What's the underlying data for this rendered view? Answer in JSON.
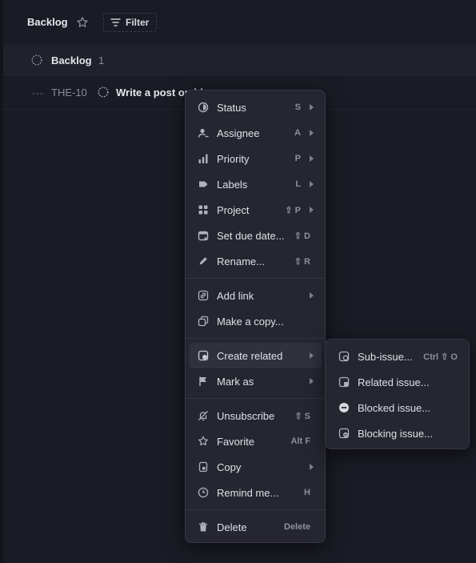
{
  "header": {
    "title": "Backlog",
    "filter_label": "Filter"
  },
  "group": {
    "name": "Backlog",
    "count": "1"
  },
  "issue": {
    "priority": "---",
    "id": "THE-10",
    "title": "Write a post on blo"
  },
  "context_menu": {
    "items": [
      {
        "label": "Status",
        "shortcut": "S",
        "icon": "status-icon",
        "submenu": true
      },
      {
        "label": "Assignee",
        "shortcut": "A",
        "icon": "assignee-icon",
        "submenu": true
      },
      {
        "label": "Priority",
        "shortcut": "P",
        "icon": "priority-icon",
        "submenu": true
      },
      {
        "label": "Labels",
        "shortcut": "L",
        "icon": "label-icon",
        "submenu": true
      },
      {
        "label": "Project",
        "shortcut": "⇧ P",
        "icon": "project-icon",
        "submenu": true
      },
      {
        "label": "Set due date...",
        "shortcut": "⇧ D",
        "icon": "calendar-icon",
        "submenu": false
      },
      {
        "label": "Rename...",
        "shortcut": "⇧ R",
        "icon": "pencil-icon",
        "submenu": false
      },
      {
        "label": "Add link",
        "shortcut": "",
        "icon": "link-icon",
        "submenu": true
      },
      {
        "label": "Make a copy...",
        "shortcut": "",
        "icon": "copy-icon",
        "submenu": false
      },
      {
        "label": "Create related",
        "shortcut": "",
        "icon": "create-related-icon",
        "submenu": true
      },
      {
        "label": "Mark as",
        "shortcut": "",
        "icon": "flag-icon",
        "submenu": true
      },
      {
        "label": "Unsubscribe",
        "shortcut": "⇧ S",
        "icon": "bell-off-icon",
        "submenu": false
      },
      {
        "label": "Favorite",
        "shortcut": "Alt F",
        "icon": "star-icon",
        "submenu": false
      },
      {
        "label": "Copy",
        "shortcut": "",
        "icon": "clipboard-icon",
        "submenu": true
      },
      {
        "label": "Remind me...",
        "shortcut": "H",
        "icon": "clock-icon",
        "submenu": false
      },
      {
        "label": "Delete",
        "shortcut": "Delete",
        "icon": "trash-icon",
        "submenu": false
      }
    ]
  },
  "submenu": {
    "items": [
      {
        "label": "Sub-issue...",
        "shortcut": "Ctrl ⇧ O",
        "icon": "sub-issue-icon"
      },
      {
        "label": "Related issue...",
        "shortcut": "",
        "icon": "related-issue-icon"
      },
      {
        "label": "Blocked issue...",
        "shortcut": "",
        "icon": "blocked-issue-icon"
      },
      {
        "label": "Blocking issue...",
        "shortcut": "",
        "icon": "blocking-issue-icon"
      }
    ]
  },
  "colors": {
    "background": "#1a1b24",
    "menu": "#252630",
    "accent_blocked": "#e8e9ee"
  }
}
